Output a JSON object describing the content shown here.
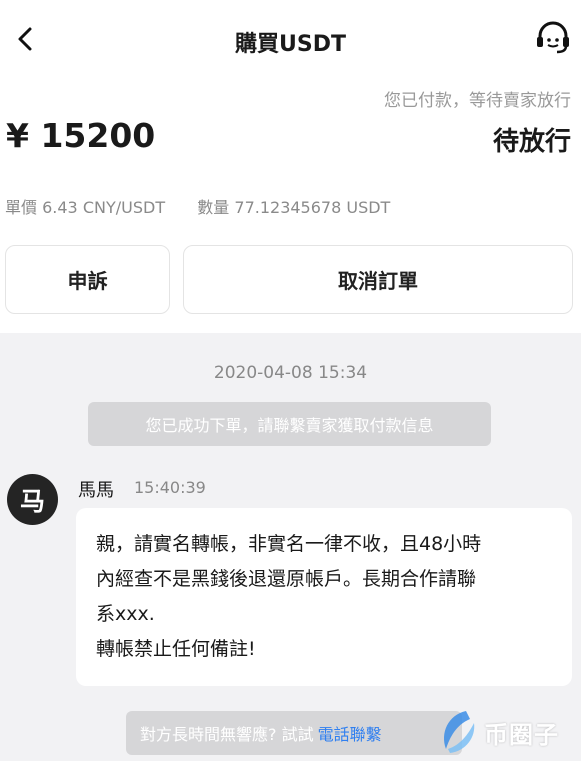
{
  "header": {
    "title": "購買USDT"
  },
  "order": {
    "status_line": "您已付款，等待賣家放行",
    "amount": "¥ 15200",
    "state": "待放行",
    "price_label": "單價",
    "price_value": "6.43 CNY/USDT",
    "quantity_label": "數量",
    "quantity_value": "77.12345678 USDT"
  },
  "actions": {
    "appeal_label": "申訴",
    "cancel_label": "取消訂單"
  },
  "chat": {
    "timestamp": "2020-04-08 15:34",
    "system_notice": "您已成功下單，請聯繫賣家獲取付款信息",
    "message": {
      "avatar_char": "马",
      "sender": "馬馬",
      "time": "15:40:39",
      "lines": [
        "親，請實名轉帳，非實名一律不收，且48小時",
        "內經查不是黑錢後退還原帳戶。長期合作請聯",
        "系xxx.",
        "轉帳禁止任何備註!"
      ]
    },
    "nudge_text": "對方長時間無響應? 試試",
    "nudge_link": "電話聯繫"
  },
  "watermark": {
    "text": "币圈子"
  },
  "icons": {
    "back": "chevron-left-icon",
    "support": "headset-icon"
  }
}
